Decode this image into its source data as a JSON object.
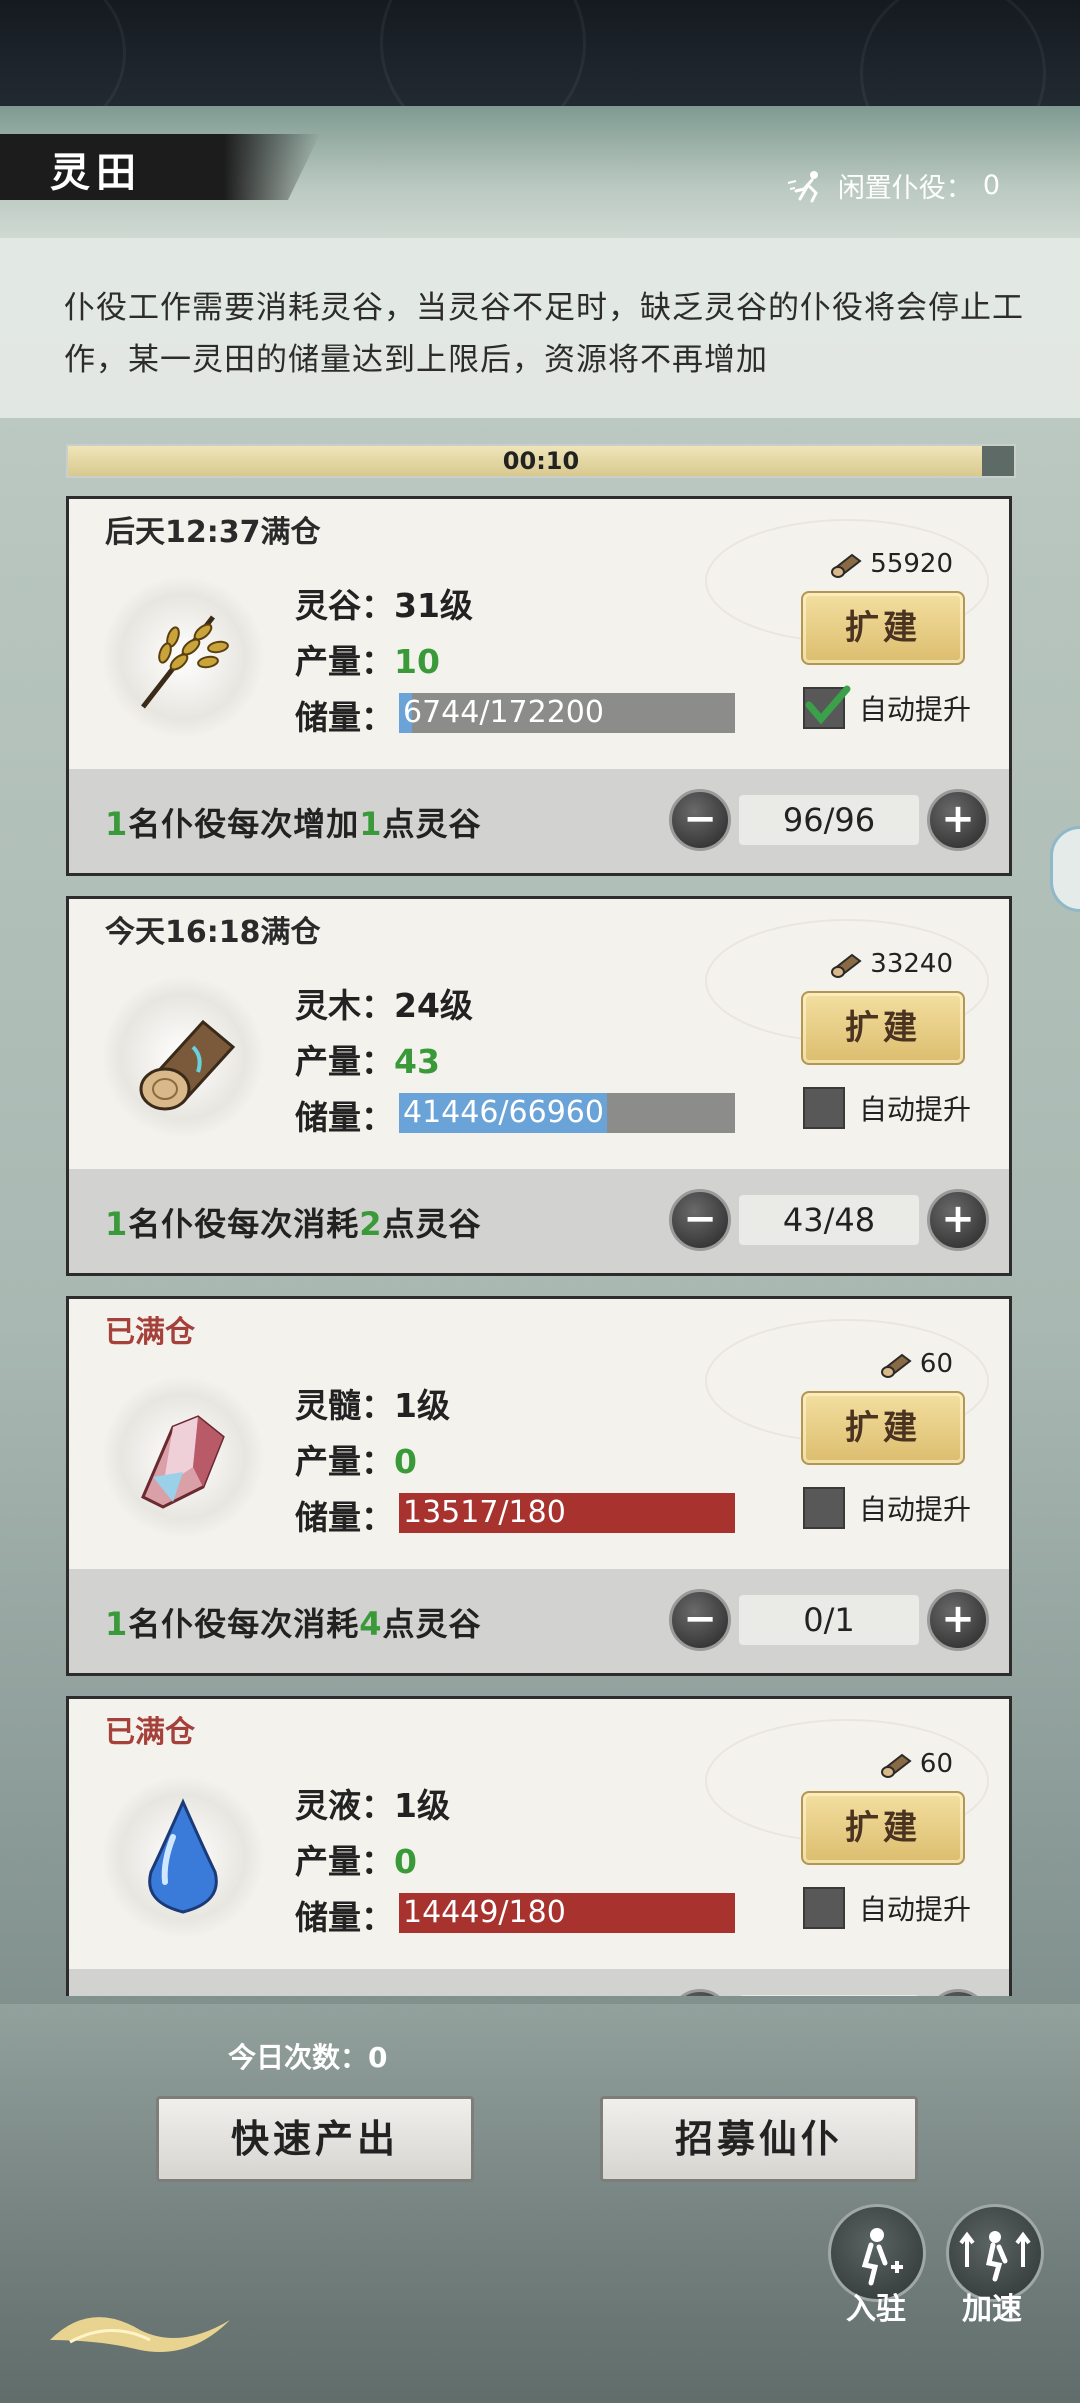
{
  "header": {
    "title": "灵田",
    "idle_label": "闲置仆役：",
    "idle_count": "0"
  },
  "description": "仆役工作需要消耗灵谷，当灵谷不足时，缺乏灵谷的仆役将会停止工作，某一灵田的储量达到上限后，资源将不再增加",
  "timer": {
    "text": "00:10",
    "progress": 0.97
  },
  "fields": [
    {
      "status": "后天12:37满仓",
      "full": false,
      "name_label": "灵谷：31级",
      "output_label": "产量：",
      "output_value": "10",
      "storage_label": "储量：",
      "storage_text": "6744/172200",
      "storage_ratio": 0.039,
      "upgrade_cost": "55920",
      "expand_label": "扩建",
      "auto_label": "自动提升",
      "auto_checked": true,
      "worker_desc_pre": "1",
      "worker_desc_mid": "名仆役每次增加",
      "worker_desc_num": "1",
      "worker_desc_post": "点灵谷",
      "workers": "96/96",
      "icon": "grain-icon"
    },
    {
      "status": "今天16:18满仓",
      "full": false,
      "name_label": "灵木：24级",
      "output_label": "产量：",
      "output_value": "43",
      "storage_label": "储量：",
      "storage_text": "41446/66960",
      "storage_ratio": 0.619,
      "upgrade_cost": "33240",
      "expand_label": "扩建",
      "auto_label": "自动提升",
      "auto_checked": false,
      "worker_desc_pre": "1",
      "worker_desc_mid": "名仆役每次消耗",
      "worker_desc_num": "2",
      "worker_desc_post": "点灵谷",
      "workers": "43/48",
      "icon": "wood-log-icon"
    },
    {
      "status": "已满仓",
      "full": true,
      "name_label": "灵髓：1级",
      "output_label": "产量：",
      "output_value": "0",
      "storage_label": "储量：",
      "storage_text": "13517/180",
      "storage_ratio": 1,
      "upgrade_cost": "60",
      "expand_label": "扩建",
      "auto_label": "自动提升",
      "auto_checked": false,
      "worker_desc_pre": "1",
      "worker_desc_mid": "名仆役每次消耗",
      "worker_desc_num": "4",
      "worker_desc_post": "点灵谷",
      "workers": "0/1",
      "icon": "crystal-icon"
    },
    {
      "status": "已满仓",
      "full": true,
      "name_label": "灵液：1级",
      "output_label": "产量：",
      "output_value": "0",
      "storage_label": "储量：",
      "storage_text": "14449/180",
      "storage_ratio": 1,
      "upgrade_cost": "60",
      "expand_label": "扩建",
      "auto_label": "自动提升",
      "auto_checked": false,
      "worker_desc_pre": "",
      "worker_desc_mid": "",
      "worker_desc_num": "",
      "worker_desc_post": "",
      "workers": "",
      "icon": "water-drop-icon"
    }
  ],
  "bottom": {
    "today_label": "今日次数：",
    "today_count": "0",
    "quick_output": "快速产出",
    "recruit": "招募仙仆",
    "station_label": "入驻",
    "speedup_label": "加速"
  },
  "colors": {
    "accent_green": "#3a9a3a",
    "full_red": "#a8332e",
    "storage_blue": "#6aa3d8",
    "button_gold": "#dcbd6e"
  }
}
